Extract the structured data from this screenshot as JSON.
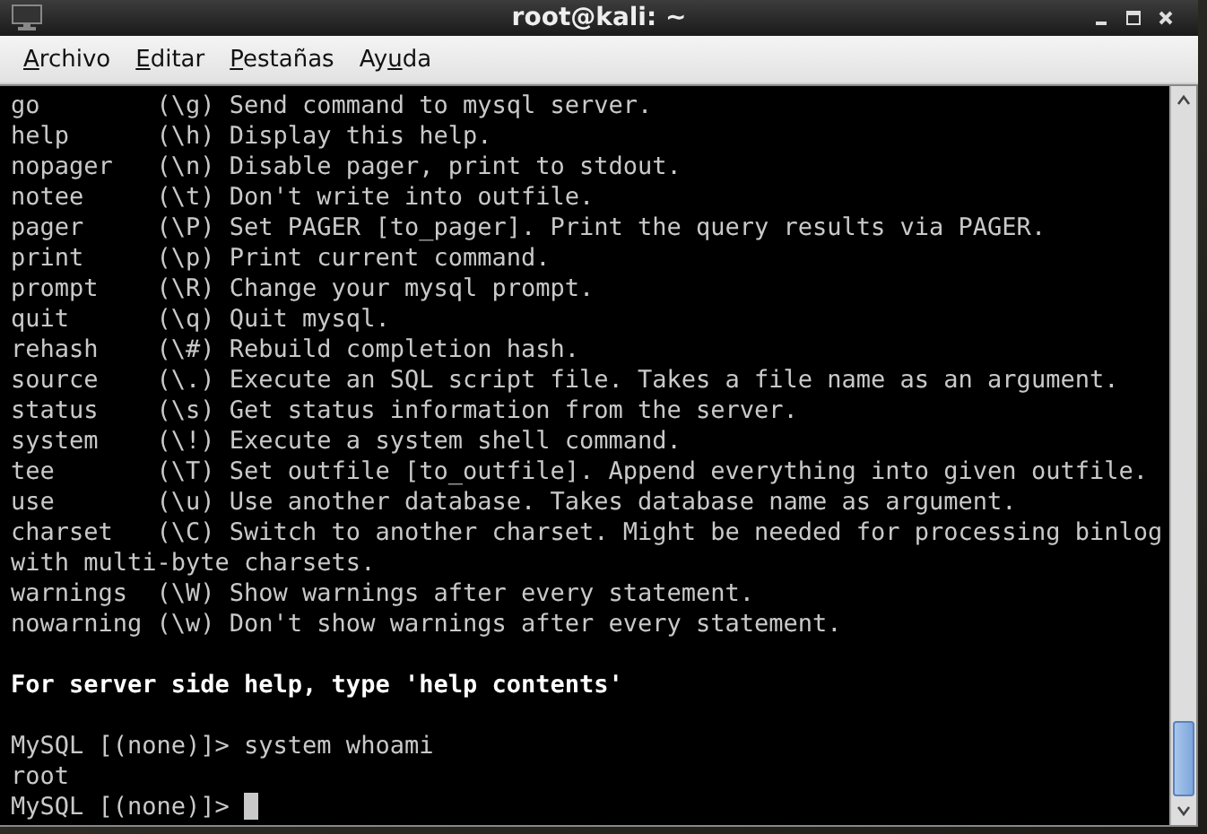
{
  "window": {
    "title": "root@kali: ~"
  },
  "menu": [
    {
      "access_key": "A",
      "rest": "rchivo"
    },
    {
      "access_key": "E",
      "rest": "ditar"
    },
    {
      "access_key": "P",
      "rest": "estañas"
    },
    {
      "lead": "Ay",
      "access_key": "u",
      "rest": "da"
    }
  ],
  "terminal": {
    "lines": [
      {
        "kind": "text",
        "text": "go        (\\g) Send command to mysql server."
      },
      {
        "kind": "text",
        "text": "help      (\\h) Display this help."
      },
      {
        "kind": "text",
        "text": "nopager   (\\n) Disable pager, print to stdout."
      },
      {
        "kind": "text",
        "text": "notee     (\\t) Don't write into outfile."
      },
      {
        "kind": "text",
        "text": "pager     (\\P) Set PAGER [to_pager]. Print the query results via PAGER."
      },
      {
        "kind": "text",
        "text": "print     (\\p) Print current command."
      },
      {
        "kind": "text",
        "text": "prompt    (\\R) Change your mysql prompt."
      },
      {
        "kind": "text",
        "text": "quit      (\\q) Quit mysql."
      },
      {
        "kind": "text",
        "text": "rehash    (\\#) Rebuild completion hash."
      },
      {
        "kind": "text",
        "text": "source    (\\.) Execute an SQL script file. Takes a file name as an argument."
      },
      {
        "kind": "text",
        "text": "status    (\\s) Get status information from the server."
      },
      {
        "kind": "text",
        "text": "system    (\\!) Execute a system shell command."
      },
      {
        "kind": "text",
        "text": "tee       (\\T) Set outfile [to_outfile]. Append everything into given outfile."
      },
      {
        "kind": "text",
        "text": "use       (\\u) Use another database. Takes database name as argument."
      },
      {
        "kind": "text",
        "text": "charset   (\\C) Switch to another charset. Might be needed for processing binlog"
      },
      {
        "kind": "text",
        "text": "with multi-byte charsets."
      },
      {
        "kind": "text",
        "text": "warnings  (\\W) Show warnings after every statement."
      },
      {
        "kind": "text",
        "text": "nowarning (\\w) Don't show warnings after every statement."
      },
      {
        "kind": "blank"
      },
      {
        "kind": "bold",
        "text": "For server side help, type 'help contents'"
      },
      {
        "kind": "blank"
      },
      {
        "kind": "text",
        "text": "MySQL [(none)]> system whoami"
      },
      {
        "kind": "text",
        "text": "root"
      },
      {
        "kind": "prompt",
        "text": "MySQL [(none)]> ",
        "cursor": true
      }
    ]
  }
}
